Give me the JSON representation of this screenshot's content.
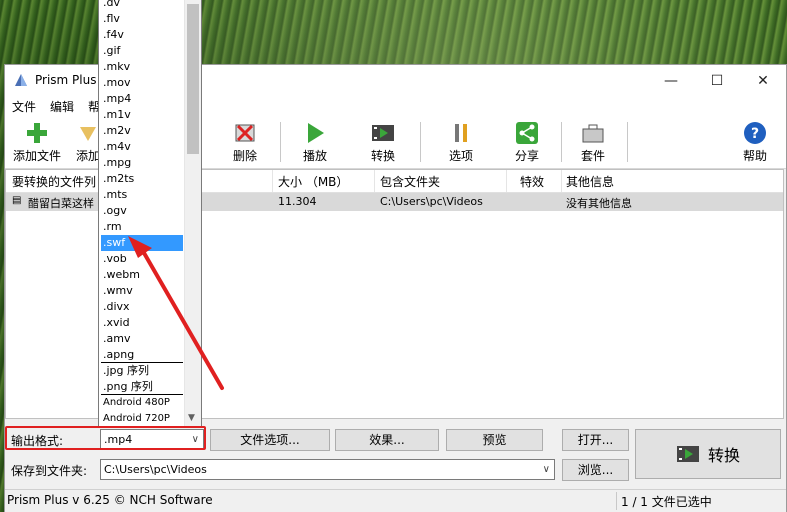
{
  "app": {
    "title": "Prism Plus",
    "menu": [
      "文件",
      "编辑",
      "帮"
    ],
    "window_controls": [
      "minimize-icon",
      "maximize-icon",
      "close-icon"
    ]
  },
  "toolbar": {
    "add_files": "添加文件",
    "add_folder": "添加",
    "delete": "删除",
    "play": "播放",
    "convert": "转换",
    "options": "选项",
    "share": "分享",
    "suite": "套件",
    "help": "帮助"
  },
  "file_list": {
    "columns": [
      "要转换的文件列",
      "大小 （MB）",
      "包含文件夹",
      "特效",
      "其他信息"
    ],
    "rows": [
      {
        "name": "醋留白菜这样",
        "size": "11.304",
        "folder": "C:\\Users\\pc\\Videos",
        "effects": "",
        "info": "没有其他信息"
      }
    ]
  },
  "format_dropdown": {
    "items": [
      ".dv",
      ".flv",
      ".f4v",
      ".gif",
      ".mkv",
      ".mov",
      ".mp4",
      ".m1v",
      ".m2v",
      ".m4v",
      ".mpg",
      ".m2ts",
      ".mts",
      ".ogv",
      ".rm",
      ".swf",
      ".vob",
      ".webm",
      ".wmv",
      ".divx",
      ".xvid",
      ".amv",
      ".apng",
      ".jpg 序列",
      ".png 序列",
      "Android 480P",
      "Android 720P"
    ],
    "selected": ".swf"
  },
  "bottom": {
    "output_format_label": "输出格式:",
    "output_format_value": ".mp4",
    "file_options": "文件选项...",
    "effects": "效果...",
    "preview": "预览",
    "open": "打开...",
    "convert_big": "转换",
    "save_to_label": "保存到文件夹:",
    "save_to_value": "C:\\Users\\pc\\Videos",
    "browse": "浏览..."
  },
  "status": {
    "left": "Prism Plus v 6.25 © NCH Software",
    "right": "1 / 1 文件已选中"
  },
  "colors": {
    "highlight": "#3399ff",
    "annotation_red": "#e02020"
  }
}
